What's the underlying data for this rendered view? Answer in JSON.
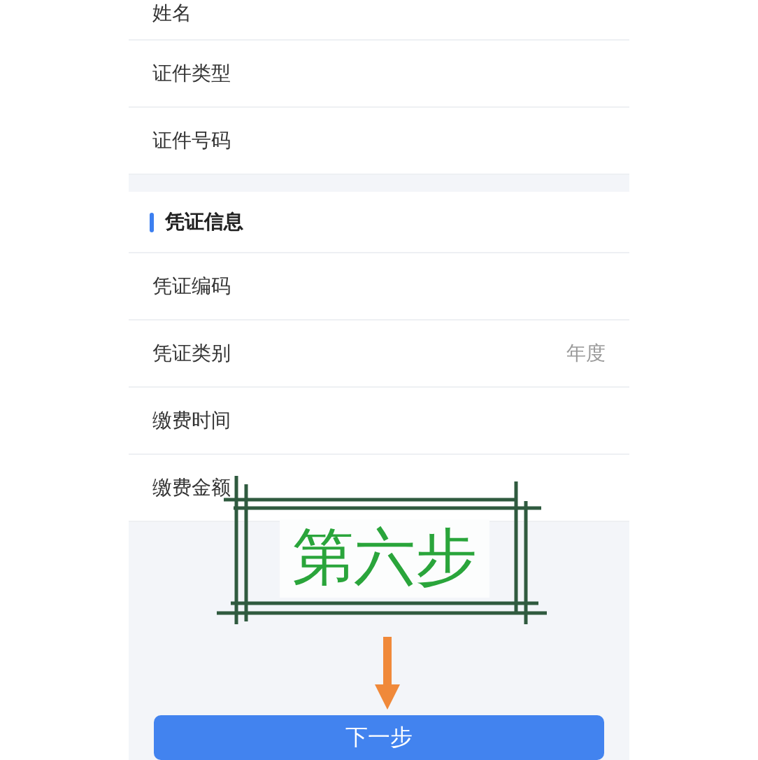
{
  "identity_rows": [
    {
      "label": "姓名"
    },
    {
      "label": "证件类型"
    },
    {
      "label": "证件号码"
    }
  ],
  "voucher_section": {
    "title": "凭证信息",
    "rows": [
      {
        "label": "凭证编码"
      },
      {
        "label": "凭证类别",
        "value": "年度"
      },
      {
        "label": "缴费时间"
      },
      {
        "label": "缴费金额"
      }
    ]
  },
  "annotation": {
    "text": "第六步"
  },
  "next_button": {
    "label": "下一步"
  }
}
